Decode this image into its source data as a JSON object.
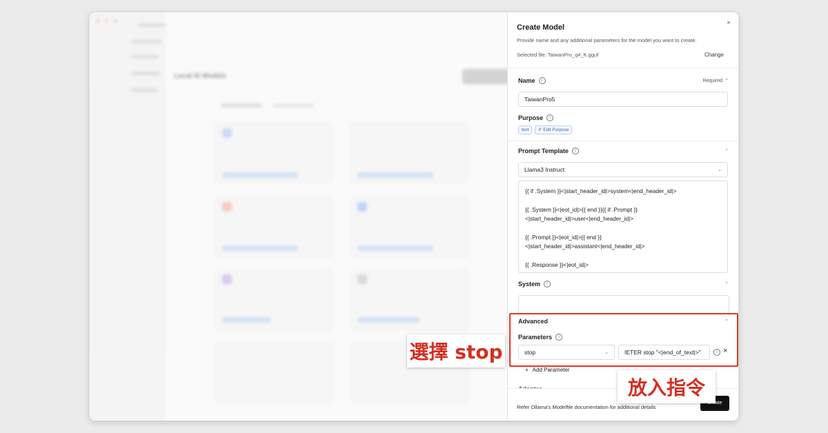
{
  "dialog": {
    "title": "Create Model",
    "description": "Provide name and any additional parameters for the model you want to create.",
    "selected_file": "Selected file: TaiwanPro_q4_K.gguf",
    "change_label": "Change",
    "close_icon": "×"
  },
  "name_section": {
    "label": "Name",
    "required": "Required",
    "value": "TaiwanPro5"
  },
  "purpose_section": {
    "label": "Purpose",
    "tag": "text",
    "edit_label": "✐ Edit Purpose"
  },
  "prompt_section": {
    "label": "Prompt Template",
    "selected": "Llama3 Instruct",
    "template": "{{ if .System }}<|start_header_id|>system<|end_header_id|>\n\n{{ .System }}<|eot_id|>{{ end }}{{ if .Prompt }}\n<|start_header_id|>user<|end_header_id|>\n\n{{ .Prompt }}<|eot_id|>{{ end }}\n<|start_header_id|>assistant<|end_header_id|>\n\n{{ .Response }}<|eot_id|>"
  },
  "system_section": {
    "label": "System"
  },
  "advanced_section": {
    "label": "Advanced",
    "parameters_label": "Parameters",
    "param_name": "stop",
    "param_value": "IETER stop \"<|end_of_text|>\"",
    "add_parameter": "Add Parameter",
    "remove_icon": "×"
  },
  "footer": {
    "note": "Refer Ollama's Modelfile documentation for additional details",
    "create_label": "Create"
  },
  "annotations": {
    "select_stop": "選擇 stop",
    "insert_command": "放入指令"
  },
  "background": {
    "page_title": "Local AI Models"
  },
  "colors": {
    "highlight": "#e53527",
    "tag": "#3465b5",
    "create_button": "#111111"
  }
}
